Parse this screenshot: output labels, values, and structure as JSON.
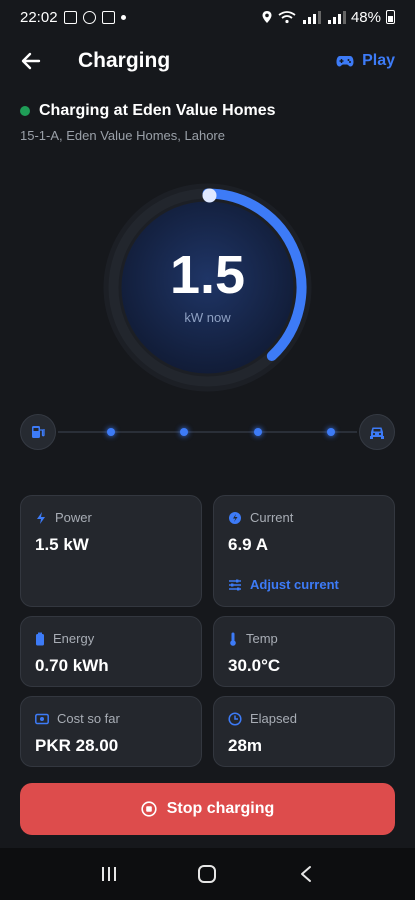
{
  "status_bar": {
    "time": "22:02",
    "battery": "48%"
  },
  "header": {
    "title": "Charging",
    "play_label": "Play"
  },
  "station": {
    "name": "Charging at Eden Value Homes",
    "address": "15-1-A, Eden Value Homes, Lahore",
    "status_color": "#1f9d57"
  },
  "gauge": {
    "value": "1.5",
    "unit": "kW now",
    "progress_fraction": 0.38,
    "accent": "#3d7bf7"
  },
  "session_track": {
    "steps": 4,
    "start_icon": "charger-station-icon",
    "end_icon": "car-icon"
  },
  "stats": {
    "power": {
      "label": "Power",
      "value": "1.5 kW",
      "icon": "bolt-icon"
    },
    "current": {
      "label": "Current",
      "value": "6.9 A",
      "icon": "current-icon",
      "action": "Adjust current"
    },
    "energy": {
      "label": "Energy",
      "value": "0.70 kWh",
      "icon": "battery-icon"
    },
    "temp": {
      "label": "Temp",
      "value": "30.0°C",
      "icon": "thermometer-icon"
    },
    "cost": {
      "label": "Cost so far",
      "value": "PKR 28.00",
      "icon": "money-icon"
    },
    "elapsed": {
      "label": "Elapsed",
      "value": "28m",
      "icon": "clock-icon"
    }
  },
  "actions": {
    "stop_label": "Stop charging",
    "stop_color": "#dd4c4c"
  }
}
